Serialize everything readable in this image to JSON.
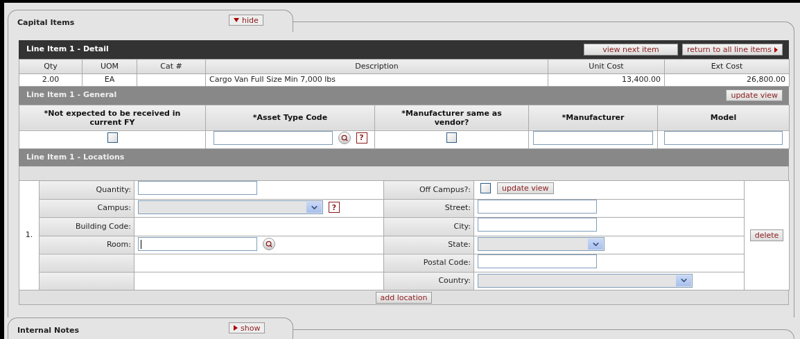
{
  "capital_items": {
    "title": "Capital Items",
    "toggle_label": "hide",
    "expanded": true,
    "detail": {
      "title": "Line Item 1 - Detail",
      "buttons": [
        {
          "label": "view next item",
          "kind": "plain"
        },
        {
          "label": "return to all line items",
          "kind": "forward"
        }
      ],
      "columns": [
        "Qty",
        "UOM",
        "Cat #",
        "Description",
        "Unit Cost",
        "Ext Cost"
      ],
      "row": [
        {
          "kind": "text",
          "text": "2.00"
        },
        {
          "kind": "text",
          "text": "EA"
        },
        {
          "kind": "empty"
        },
        {
          "kind": "text",
          "text": "Cargo Van Full Size Min 7,000 lbs"
        },
        {
          "kind": "text",
          "text": "13,400.00"
        },
        {
          "kind": "text",
          "text": "26,800.00"
        }
      ]
    },
    "general": {
      "title": "Line Item 1 - General",
      "button": "update view",
      "columns": [
        "*Not expected to be received in current FY",
        "*Asset Type Code",
        "*Manufacturer same as vendor?",
        "*Manufacturer",
        "Model"
      ],
      "fields": [
        {
          "kind": "checkbox",
          "checked": false
        },
        {
          "kind": "text",
          "lookup": true,
          "help": "?"
        },
        {
          "kind": "checkbox",
          "checked": false
        },
        {
          "kind": "text"
        },
        {
          "kind": "text"
        }
      ]
    },
    "locations": {
      "title": "Line Item 1 - Locations",
      "entries": [
        {
          "number": "1.",
          "delete_button": "delete",
          "left": [
            {
              "label": "Quantity:",
              "kind": "text"
            },
            {
              "label": "Campus:",
              "kind": "select",
              "help": "?"
            },
            {
              "label": "Building Code:",
              "kind": "plain"
            },
            {
              "label": "Room:",
              "kind": "text",
              "lookup": true,
              "focused": true
            },
            {
              "kind": "empty"
            },
            {
              "kind": "empty"
            }
          ],
          "right": [
            {
              "label": "Off Campus?:",
              "kind": "checkbox",
              "checked": false,
              "button": "update view"
            },
            {
              "label": "Street:",
              "kind": "text"
            },
            {
              "label": "City:",
              "kind": "text"
            },
            {
              "label": "State:",
              "kind": "select_short"
            },
            {
              "label": "Postal Code:",
              "kind": "text"
            },
            {
              "label": "Country:",
              "kind": "select"
            }
          ]
        }
      ],
      "add_button": "add location"
    }
  },
  "internal_notes": {
    "title": "Internal Notes",
    "toggle_label": "show",
    "expanded": false
  }
}
